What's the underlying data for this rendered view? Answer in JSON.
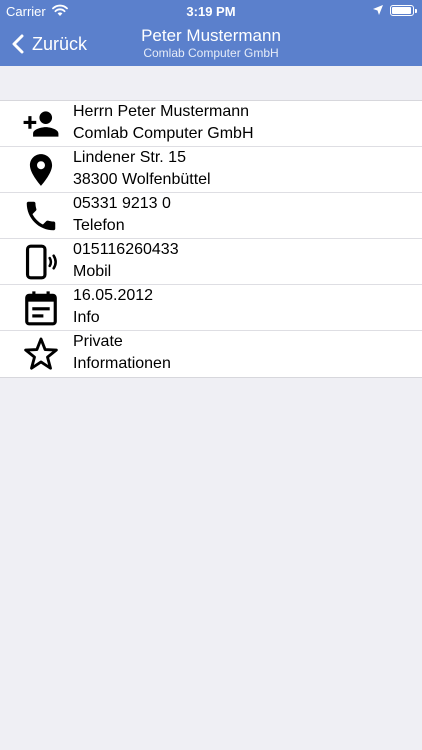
{
  "status": {
    "carrier": "Carrier",
    "time": "3:19 PM",
    "battery_level": 0.95
  },
  "nav": {
    "back_label": "Zurück",
    "title": "Peter Mustermann",
    "subtitle": "Comlab Computer GmbH"
  },
  "rows": [
    {
      "icon": "add-person-icon",
      "line1": "Herrn Peter Mustermann",
      "line2": "Comlab Computer GmbH"
    },
    {
      "icon": "location-pin-icon",
      "line1": "Lindener Str. 15",
      "line2": "38300 Wolfenbüttel"
    },
    {
      "icon": "phone-icon",
      "line1": "05331 9213 0",
      "line2": "Telefon"
    },
    {
      "icon": "mobile-phone-icon",
      "line1": "015116260433",
      "line2": "Mobil"
    },
    {
      "icon": "calendar-icon",
      "line1": "16.05.2012",
      "line2": "Info"
    },
    {
      "icon": "star-icon",
      "line1": "Private",
      "line2": "Informationen"
    }
  ],
  "colors": {
    "nav_bar": "#5b80cc",
    "background": "#efeff4",
    "row": "#ffffff"
  }
}
